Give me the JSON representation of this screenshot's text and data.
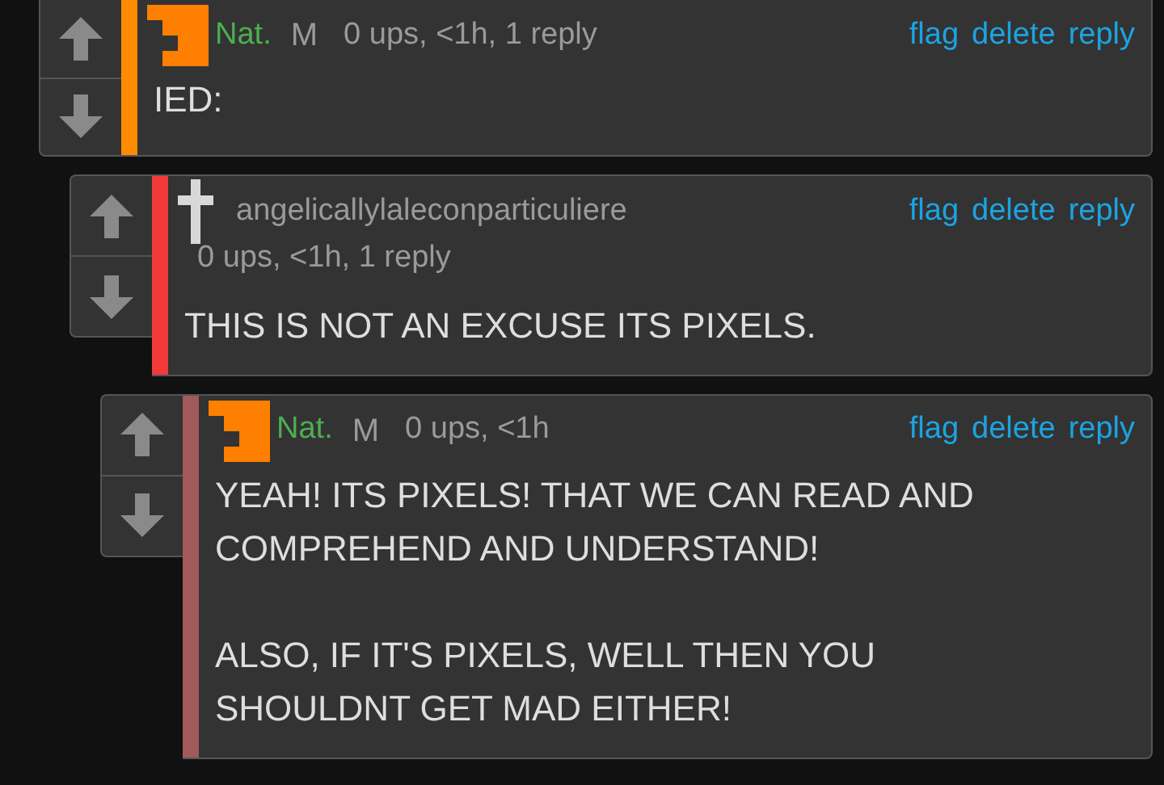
{
  "comments": [
    {
      "avatar": {
        "kind": "pixel"
      },
      "user": {
        "name": "Nat.",
        "color": "#4caf50"
      },
      "color": "#ff8c00",
      "tag": "M",
      "meta": "0 ups, <1h, 1 reply",
      "actions": [
        "flag",
        "delete",
        "reply"
      ],
      "body": [
        "IED:"
      ],
      "children": [
        {
          "avatar": {
            "kind": "cross"
          },
          "user": {
            "name": "angelicallylaleconparticuliere",
            "color": "#9a9a9a"
          },
          "color": "#f23a3a",
          "meta": "0 ups, <1h, 1 reply",
          "actions": [
            "flag",
            "delete",
            "reply"
          ],
          "body": [
            "THIS IS NOT AN EXCUSE ITS PIXELS."
          ],
          "children": [
            {
              "avatar": {
                "kind": "pixel"
              },
              "user": {
                "name": "Nat.",
                "color": "#4caf50"
              },
              "color": "#a05a5a",
              "tag": "M",
              "meta": "0 ups, <1h",
              "actions": [
                "flag",
                "delete",
                "reply"
              ],
              "body": [
                "YEAH! ITS PIXELS! THAT WE CAN READ AND COMPREHEND AND UNDERSTAND!",
                "ALSO, IF IT'S PIXELS, WELL THEN YOU SHOULDNT GET MAD EITHER!"
              ]
            }
          ]
        }
      ]
    }
  ]
}
